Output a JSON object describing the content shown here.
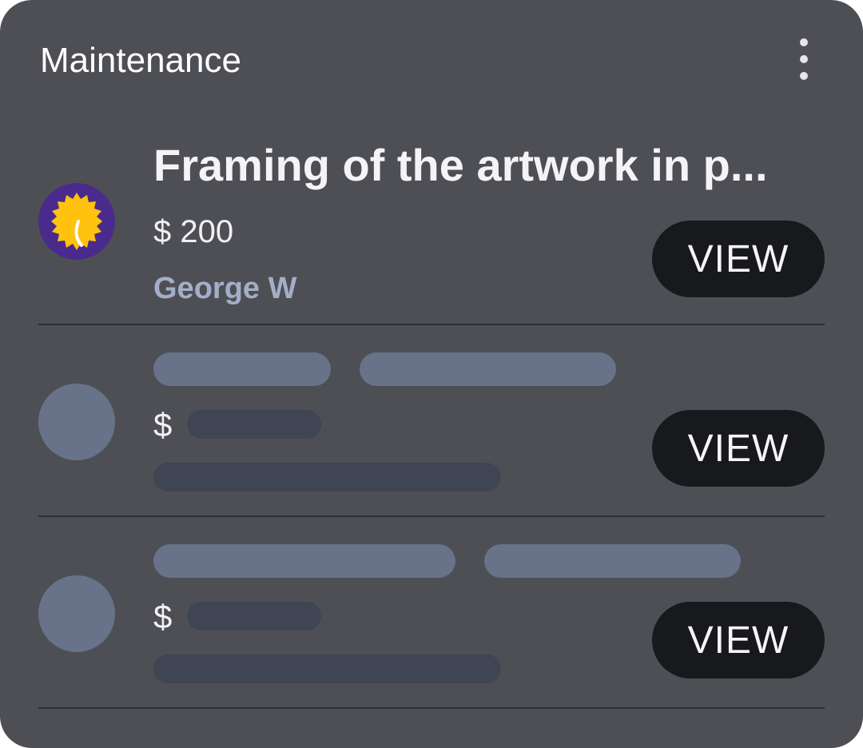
{
  "card": {
    "title": "Maintenance",
    "menu_icon": "more-vert-icon"
  },
  "items": [
    {
      "title": "Framing of the artwork in p...",
      "price": "$ 200",
      "author": "George W",
      "avatar_icon": "sun-badge-icon",
      "button": "VIEW"
    },
    {
      "currency": "$",
      "button": "VIEW",
      "loading": true
    },
    {
      "currency": "$",
      "button": "VIEW",
      "loading": true
    }
  ],
  "colors": {
    "card_bg": "#4e4f55",
    "button_bg": "#18191c",
    "author": "#a3aec8",
    "skeleton_light": "#687289",
    "skeleton_dark": "#3f4553",
    "avatar_bg": "#4a2a8c",
    "avatar_sun": "#ffc20e"
  }
}
